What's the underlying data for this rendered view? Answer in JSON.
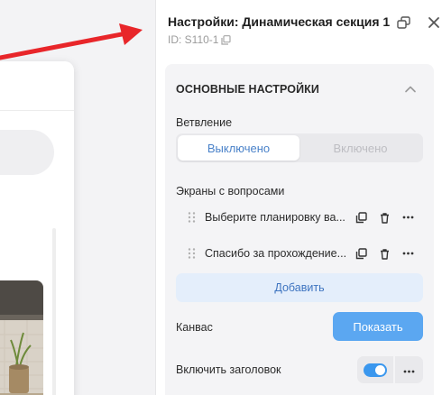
{
  "panel": {
    "title": "Настройки: Динамическая секция 1",
    "id_text": "ID: S110-1"
  },
  "section": {
    "title": "ОСНОВНЫЕ НАСТРОЙКИ",
    "branching": {
      "label": "Ветвление",
      "options": [
        "Выключено",
        "Включено"
      ],
      "selected": "Выключено"
    },
    "screens": {
      "label": "Экраны с вопросами",
      "items": [
        {
          "text": "Выберите планировку ва..."
        },
        {
          "text": "Спасибо за прохождение..."
        }
      ],
      "add_label": "Добавить"
    },
    "canvas": {
      "label": "Канвас",
      "button_label": "Показать"
    },
    "header_toggle": {
      "label": "Включить заголовок",
      "enabled": true
    }
  },
  "colors": {
    "accent": "#5ba7f1",
    "toggle_on": "#3a97ee",
    "arrow": "#e8262a",
    "link_blue": "#3e74c0"
  },
  "icons": [
    "popout-icon",
    "close-icon",
    "copy-icon",
    "chevron-up-icon",
    "drag-handle-icon",
    "duplicate-icon",
    "trash-icon",
    "more-icon"
  ]
}
